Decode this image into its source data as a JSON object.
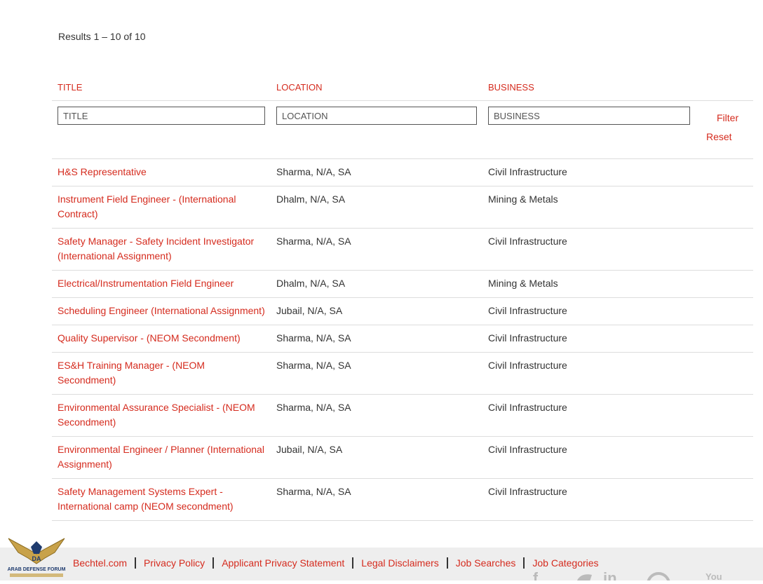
{
  "results_text": "Results 1 – 10 of 10",
  "columns": {
    "title": "TITLE",
    "location": "LOCATION",
    "business": "BUSINESS"
  },
  "filters": {
    "title_placeholder": "TITLE",
    "location_placeholder": "LOCATION",
    "business_placeholder": "BUSINESS",
    "filter_label": "Filter",
    "reset_label": "Reset"
  },
  "jobs": [
    {
      "title": "H&S Representative",
      "location": "Sharma, N/A, SA",
      "business": "Civil Infrastructure"
    },
    {
      "title": "Instrument Field Engineer - (International Contract)",
      "location": "Dhalm, N/A, SA",
      "business": "Mining & Metals"
    },
    {
      "title": "Safety Manager - Safety Incident Investigator (International Assignment)",
      "location": "Sharma, N/A, SA",
      "business": "Civil Infrastructure"
    },
    {
      "title": "Electrical/Instrumentation Field Engineer",
      "location": "Dhalm, N/A, SA",
      "business": "Mining & Metals"
    },
    {
      "title": "Scheduling Engineer (International Assignment)",
      "location": "Jubail, N/A, SA",
      "business": "Civil Infrastructure"
    },
    {
      "title": "Quality Supervisor - (NEOM Secondment)",
      "location": "Sharma, N/A, SA",
      "business": "Civil Infrastructure"
    },
    {
      "title": "ES&H Training Manager - (NEOM Secondment)",
      "location": "Sharma, N/A, SA",
      "business": "Civil Infrastructure"
    },
    {
      "title": "Environmental Assurance Specialist - (NEOM Secondment)",
      "location": "Sharma, N/A, SA",
      "business": "Civil Infrastructure"
    },
    {
      "title": "Environmental Engineer / Planner (International Assignment)",
      "location": "Jubail, N/A, SA",
      "business": "Civil Infrastructure"
    },
    {
      "title": "Safety Management Systems Expert - International camp (NEOM secondment)",
      "location": "Sharma, N/A, SA",
      "business": "Civil Infrastructure"
    }
  ],
  "footer": {
    "links": [
      "Bechtel.com",
      "Privacy Policy",
      "Applicant Privacy Statement",
      "Legal Disclaimers",
      "Job Searches",
      "Job Categories"
    ],
    "logo_text": "ARAB DEFENSE FORUM",
    "logo_monogram": "DA",
    "social": {
      "youtube": "You"
    }
  },
  "colors": {
    "accent": "#d52b1e",
    "text": "#333333",
    "footer_bg": "#eeeeee"
  },
  "icons": {
    "facebook": "facebook-icon",
    "twitter": "twitter-icon",
    "linkedin": "linkedin-icon",
    "pinterest": "pinterest-icon",
    "youtube": "youtube-icon",
    "logo": "eagle-logo-icon"
  }
}
